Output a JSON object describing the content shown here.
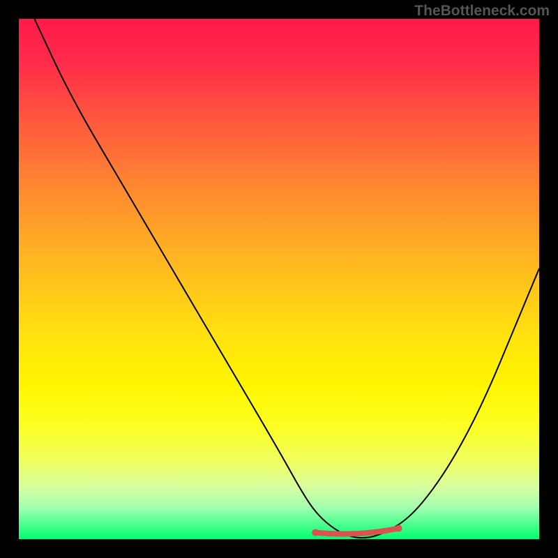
{
  "watermark": "TheBottleneck.com",
  "chart_data": {
    "type": "line",
    "title": "",
    "xlabel": "",
    "ylabel": "",
    "xlim": [
      0,
      100
    ],
    "ylim": [
      0,
      100
    ],
    "series": [
      {
        "name": "bottleneck-curve",
        "x": [
          3,
          10,
          20,
          30,
          40,
          50,
          55,
          58,
          62,
          66,
          70,
          75,
          80,
          85,
          90,
          95,
          100
        ],
        "y": [
          100,
          85,
          68,
          51,
          34,
          17,
          8,
          4,
          1,
          0,
          1,
          4,
          10,
          18,
          28,
          40,
          52
        ]
      }
    ],
    "optimal_range": {
      "x_start": 57,
      "x_end": 73,
      "y": 1
    },
    "background": "rainbow-gradient-red-to-green"
  }
}
